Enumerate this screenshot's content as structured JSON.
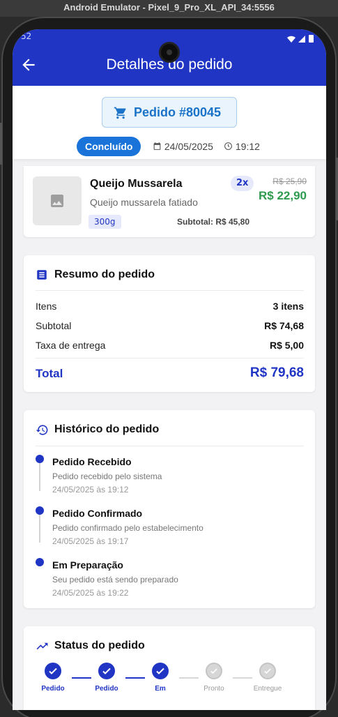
{
  "emulator": {
    "title": "Android Emulator - Pixel_9_Pro_XL_API_34:5556"
  },
  "statusbar": {
    "clock": "52"
  },
  "appbar": {
    "title": "Detalhes do pedido"
  },
  "order": {
    "label": "Pedido #80045",
    "status": "Concluído",
    "date": "24/05/2025",
    "time": "19:12"
  },
  "item": {
    "name": "Queijo Mussarela",
    "description": "Queijo mussarela fatiado",
    "quantity": "2x",
    "old_price": "R$ 25,90",
    "price": "R$ 22,90",
    "weight": "300g",
    "subtotal": "Subtotal: R$ 45,80"
  },
  "summary": {
    "title": "Resumo do pedido",
    "rows": [
      {
        "label": "Itens",
        "value": "3 itens"
      },
      {
        "label": "Subtotal",
        "value": "R$ 74,68"
      },
      {
        "label": "Taxa de entrega",
        "value": "R$ 5,00"
      }
    ],
    "total_label": "Total",
    "total_value": "R$ 79,68"
  },
  "history": {
    "title": "Histórico do pedido",
    "events": [
      {
        "title": "Pedido Recebido",
        "description": "Pedido recebido pelo sistema",
        "time": "24/05/2025 às 19:12"
      },
      {
        "title": "Pedido Confirmado",
        "description": "Pedido confirmado pelo estabelecimento",
        "time": "24/05/2025 às 19:17"
      },
      {
        "title": "Em Preparação",
        "description": "Seu pedido está sendo preparado",
        "time": "24/05/2025 às 19:22"
      }
    ]
  },
  "status": {
    "title": "Status do pedido",
    "steps": [
      {
        "label": "Pedido",
        "state": "done"
      },
      {
        "label": "Pedido",
        "state": "done"
      },
      {
        "label": "Em",
        "state": "done"
      },
      {
        "label": "Pronto",
        "state": "pending"
      },
      {
        "label": "Entregue",
        "state": "pending"
      }
    ]
  },
  "colors": {
    "primary": "#2035c4",
    "accent_blue": "#1a73d9",
    "price_green": "#2e9a4e"
  }
}
